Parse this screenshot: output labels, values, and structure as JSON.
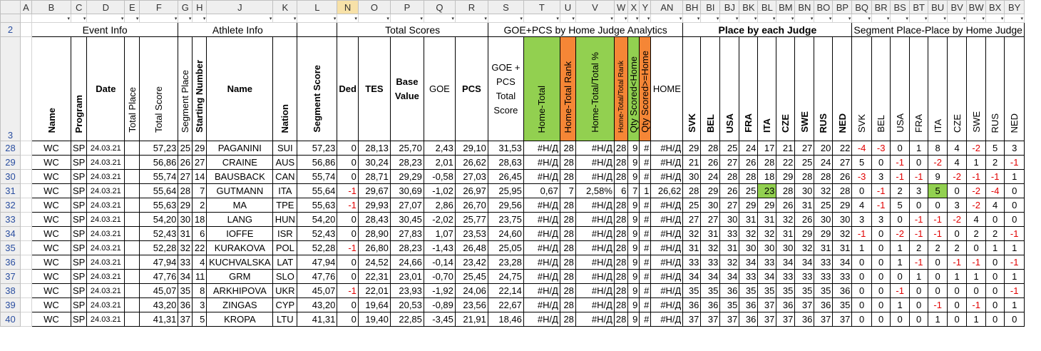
{
  "columns": [
    "",
    "A",
    "B",
    "C",
    "D",
    "E",
    "F",
    "G",
    "H",
    "J",
    "K",
    "L",
    "N",
    "O",
    "P",
    "Q",
    "R",
    "S",
    "T",
    "U",
    "V",
    "W",
    "X",
    "Y",
    "AN",
    "BH",
    "BI",
    "BJ",
    "BK",
    "BL",
    "BM",
    "BN",
    "BO",
    "BP",
    "BQ",
    "BR",
    "BS",
    "BT",
    "BU",
    "BV",
    "BW",
    "BX",
    "BY"
  ],
  "selected_column": "N",
  "header_row_numbers": [
    "",
    "2",
    "3"
  ],
  "groups": {
    "event_info": "Event Info",
    "athlete_info": "Athlete Info",
    "total_scores": "Total Scores",
    "goe_pcs": "GOE+PCS by Home Judge Analytics",
    "place_each_judge": "Place by each Judge",
    "segment_place": "Segment Place-Place by Home Judge"
  },
  "headers": {
    "name": "Name",
    "program": "Program",
    "date": "Date",
    "total_place": "Total Place",
    "total_score": "Total Score",
    "segment_place": "Segment Place",
    "starting_number": "Starting Number",
    "athlete_name": "Name",
    "nation": "Nation",
    "segment_score": "Segment Score",
    "ded": "Ded",
    "tes": "TES",
    "base_value": "Base Value",
    "goe": "GOE",
    "pcs": "PCS",
    "goe_pcs_total": "GOE + PCS Total Score",
    "home_total": "Home-Total",
    "home_total_rank": "Home-Total Rank",
    "home_total_pct": "Home-Total/Total %",
    "home_total_total_rank": "Home-Total/Total Rank",
    "qty_lt": "Qty Scored<Home",
    "qty_ge": "Qty Scored>=Home",
    "home": "HOME",
    "judges": [
      "SVK",
      "BEL",
      "USA",
      "FRA",
      "ITA",
      "CZE",
      "SWE",
      "RUS",
      "NED"
    ],
    "seg_judges": [
      "SVK",
      "BEL",
      "USA",
      "FRA",
      "ITA",
      "CZE",
      "SWE",
      "RUS",
      "NED"
    ]
  },
  "rows": [
    {
      "row": "28",
      "ev": "WC",
      "prog": "SP",
      "date": "24.03.21",
      "tp": "",
      "ts": "57,23",
      "sp": "25",
      "sn": "29",
      "name": "PAGANINI",
      "nat": "SUI",
      "ss": "57,23",
      "ded": "0",
      "tes": "28,13",
      "bv": "25,70",
      "goe": "2,43",
      "pcs": "29,10",
      "gp": "31,53",
      "ht": "#Н/Д",
      "htr": "28",
      "htp": "#Н/Д",
      "httr": "28",
      "ql": "9",
      "qg": "#",
      "home": "#Н/Д",
      "pl": [
        "29",
        "28",
        "25",
        "24",
        "17",
        "21",
        "27",
        "20",
        "22"
      ],
      "sg": [
        "-4",
        "-3",
        "0",
        "1",
        "8",
        "4",
        "-2",
        "5",
        "3"
      ]
    },
    {
      "row": "29",
      "ev": "WC",
      "prog": "SP",
      "date": "24.03.21",
      "tp": "",
      "ts": "56,86",
      "sp": "26",
      "sn": "27",
      "name": "CRAINE",
      "nat": "AUS",
      "ss": "56,86",
      "ded": "0",
      "tes": "30,24",
      "bv": "28,23",
      "goe": "2,01",
      "pcs": "26,62",
      "gp": "28,63",
      "ht": "#Н/Д",
      "htr": "28",
      "htp": "#Н/Д",
      "httr": "28",
      "ql": "9",
      "qg": "#",
      "home": "#Н/Д",
      "pl": [
        "21",
        "26",
        "27",
        "26",
        "28",
        "22",
        "25",
        "24",
        "27"
      ],
      "sg": [
        "5",
        "0",
        "-1",
        "0",
        "-2",
        "4",
        "1",
        "2",
        "-1"
      ]
    },
    {
      "row": "30",
      "ev": "WC",
      "prog": "SP",
      "date": "24.03.21",
      "tp": "",
      "ts": "55,74",
      "sp": "27",
      "sn": "14",
      "name": "BAUSBACK",
      "nat": "CAN",
      "ss": "55,74",
      "ded": "0",
      "tes": "28,71",
      "bv": "29,29",
      "goe": "-0,58",
      "pcs": "27,03",
      "gp": "26,45",
      "ht": "#Н/Д",
      "htr": "28",
      "htp": "#Н/Д",
      "httr": "28",
      "ql": "9",
      "qg": "#",
      "home": "#Н/Д",
      "pl": [
        "30",
        "24",
        "28",
        "28",
        "18",
        "29",
        "28",
        "28",
        "26"
      ],
      "sg": [
        "-3",
        "3",
        "-1",
        "-1",
        "9",
        "-2",
        "-1",
        "-1",
        "1"
      ]
    },
    {
      "row": "31",
      "ev": "WC",
      "prog": "SP",
      "date": "24.03.21",
      "tp": "",
      "ts": "55,64",
      "sp": "28",
      "sn": "7",
      "name": "GUTMANN",
      "nat": "ITA",
      "ss": "55,64",
      "ded": "-1",
      "tes": "29,67",
      "bv": "30,69",
      "goe": "-1,02",
      "pcs": "26,97",
      "gp": "25,95",
      "ht": "0,67",
      "htr": "7",
      "htp": "2,58%",
      "httr": "6",
      "ql": "7",
      "qg": "1",
      "home": "26,62",
      "pl": [
        "28",
        "29",
        "26",
        "25",
        "23",
        "28",
        "30",
        "32",
        "28"
      ],
      "sg": [
        "0",
        "-1",
        "2",
        "3",
        "5",
        "0",
        "-2",
        "-4",
        "0"
      ]
    },
    {
      "row": "32",
      "ev": "WC",
      "prog": "SP",
      "date": "24.03.21",
      "tp": "",
      "ts": "55,63",
      "sp": "29",
      "sn": "2",
      "name": "MA",
      "nat": "TPE",
      "ss": "55,63",
      "ded": "-1",
      "tes": "29,93",
      "bv": "27,07",
      "goe": "2,86",
      "pcs": "26,70",
      "gp": "29,56",
      "ht": "#Н/Д",
      "htr": "28",
      "htp": "#Н/Д",
      "httr": "28",
      "ql": "9",
      "qg": "#",
      "home": "#Н/Д",
      "pl": [
        "25",
        "30",
        "27",
        "29",
        "29",
        "26",
        "31",
        "25",
        "29"
      ],
      "sg": [
        "4",
        "-1",
        "5",
        "0",
        "0",
        "3",
        "-2",
        "4",
        "0"
      ]
    },
    {
      "row": "33",
      "ev": "WC",
      "prog": "SP",
      "date": "24.03.21",
      "tp": "",
      "ts": "54,20",
      "sp": "30",
      "sn": "18",
      "name": "LANG",
      "nat": "HUN",
      "ss": "54,20",
      "ded": "0",
      "tes": "28,43",
      "bv": "30,45",
      "goe": "-2,02",
      "pcs": "25,77",
      "gp": "23,75",
      "ht": "#Н/Д",
      "htr": "28",
      "htp": "#Н/Д",
      "httr": "28",
      "ql": "9",
      "qg": "#",
      "home": "#Н/Д",
      "pl": [
        "27",
        "27",
        "30",
        "31",
        "31",
        "32",
        "26",
        "30",
        "30"
      ],
      "sg": [
        "3",
        "3",
        "0",
        "-1",
        "-1",
        "-2",
        "4",
        "0",
        "0"
      ]
    },
    {
      "row": "34",
      "ev": "WC",
      "prog": "SP",
      "date": "24.03.21",
      "tp": "",
      "ts": "52,43",
      "sp": "31",
      "sn": "6",
      "name": "IOFFE",
      "nat": "ISR",
      "ss": "52,43",
      "ded": "0",
      "tes": "28,90",
      "bv": "27,83",
      "goe": "1,07",
      "pcs": "23,53",
      "gp": "24,60",
      "ht": "#Н/Д",
      "htr": "28",
      "htp": "#Н/Д",
      "httr": "28",
      "ql": "9",
      "qg": "#",
      "home": "#Н/Д",
      "pl": [
        "32",
        "31",
        "33",
        "32",
        "32",
        "31",
        "29",
        "29",
        "32"
      ],
      "sg": [
        "-1",
        "0",
        "-2",
        "-1",
        "-1",
        "0",
        "2",
        "2",
        "-1"
      ]
    },
    {
      "row": "35",
      "ev": "WC",
      "prog": "SP",
      "date": "24.03.21",
      "tp": "",
      "ts": "52,28",
      "sp": "32",
      "sn": "22",
      "name": "KURAKOVA",
      "nat": "POL",
      "ss": "52,28",
      "ded": "-1",
      "tes": "26,80",
      "bv": "28,23",
      "goe": "-1,43",
      "pcs": "26,48",
      "gp": "25,05",
      "ht": "#Н/Д",
      "htr": "28",
      "htp": "#Н/Д",
      "httr": "28",
      "ql": "9",
      "qg": "#",
      "home": "#Н/Д",
      "pl": [
        "31",
        "32",
        "31",
        "30",
        "30",
        "30",
        "32",
        "31",
        "31"
      ],
      "sg": [
        "1",
        "0",
        "1",
        "2",
        "2",
        "2",
        "0",
        "1",
        "1"
      ]
    },
    {
      "row": "36",
      "ev": "WC",
      "prog": "SP",
      "date": "24.03.21",
      "tp": "",
      "ts": "47,94",
      "sp": "33",
      "sn": "4",
      "name": "KUCHVALSKA",
      "nat": "LAT",
      "ss": "47,94",
      "ded": "0",
      "tes": "24,52",
      "bv": "24,66",
      "goe": "-0,14",
      "pcs": "23,42",
      "gp": "23,28",
      "ht": "#Н/Д",
      "htr": "28",
      "htp": "#Н/Д",
      "httr": "28",
      "ql": "9",
      "qg": "#",
      "home": "#Н/Д",
      "pl": [
        "33",
        "33",
        "32",
        "34",
        "33",
        "34",
        "34",
        "33",
        "34"
      ],
      "sg": [
        "0",
        "0",
        "1",
        "-1",
        "0",
        "-1",
        "-1",
        "0",
        "-1"
      ]
    },
    {
      "row": "37",
      "ev": "WC",
      "prog": "SP",
      "date": "24.03.21",
      "tp": "",
      "ts": "47,76",
      "sp": "34",
      "sn": "11",
      "name": "GRM",
      "nat": "SLO",
      "ss": "47,76",
      "ded": "0",
      "tes": "22,31",
      "bv": "23,01",
      "goe": "-0,70",
      "pcs": "25,45",
      "gp": "24,75",
      "ht": "#Н/Д",
      "htr": "28",
      "htp": "#Н/Д",
      "httr": "28",
      "ql": "9",
      "qg": "#",
      "home": "#Н/Д",
      "pl": [
        "34",
        "34",
        "34",
        "33",
        "34",
        "33",
        "33",
        "33",
        "33"
      ],
      "sg": [
        "0",
        "0",
        "0",
        "1",
        "0",
        "1",
        "1",
        "0",
        "1"
      ]
    },
    {
      "row": "38",
      "ev": "WC",
      "prog": "SP",
      "date": "24.03.21",
      "tp": "",
      "ts": "45,07",
      "sp": "35",
      "sn": "8",
      "name": "ARKHIPOVA",
      "nat": "UKR",
      "ss": "45,07",
      "ded": "-1",
      "tes": "22,01",
      "bv": "23,93",
      "goe": "-1,92",
      "pcs": "24,06",
      "gp": "22,14",
      "ht": "#Н/Д",
      "htr": "28",
      "htp": "#Н/Д",
      "httr": "28",
      "ql": "9",
      "qg": "#",
      "home": "#Н/Д",
      "pl": [
        "35",
        "35",
        "36",
        "35",
        "35",
        "35",
        "35",
        "35",
        "36"
      ],
      "sg": [
        "0",
        "0",
        "-1",
        "0",
        "0",
        "0",
        "0",
        "0",
        "-1"
      ]
    },
    {
      "row": "39",
      "ev": "WC",
      "prog": "SP",
      "date": "24.03.21",
      "tp": "",
      "ts": "43,20",
      "sp": "36",
      "sn": "3",
      "name": "ZINGAS",
      "nat": "CYP",
      "ss": "43,20",
      "ded": "0",
      "tes": "19,64",
      "bv": "20,53",
      "goe": "-0,89",
      "pcs": "23,56",
      "gp": "22,67",
      "ht": "#Н/Д",
      "htr": "28",
      "htp": "#Н/Д",
      "httr": "28",
      "ql": "9",
      "qg": "#",
      "home": "#Н/Д",
      "pl": [
        "36",
        "36",
        "35",
        "36",
        "37",
        "36",
        "37",
        "36",
        "35"
      ],
      "sg": [
        "0",
        "0",
        "1",
        "0",
        "-1",
        "0",
        "-1",
        "0",
        "1"
      ]
    },
    {
      "row": "40",
      "ev": "WC",
      "prog": "SP",
      "date": "24.03.21",
      "tp": "",
      "ts": "41,31",
      "sp": "37",
      "sn": "5",
      "name": "KROPA",
      "nat": "LTU",
      "ss": "41,31",
      "ded": "0",
      "tes": "19,40",
      "bv": "22,85",
      "goe": "-3,45",
      "pcs": "21,91",
      "gp": "18,46",
      "ht": "#Н/Д",
      "htr": "28",
      "htp": "#Н/Д",
      "httr": "28",
      "ql": "9",
      "qg": "#",
      "home": "#Н/Д",
      "pl": [
        "37",
        "37",
        "37",
        "36",
        "37",
        "37",
        "36",
        "37",
        "37"
      ],
      "sg": [
        "0",
        "0",
        "0",
        "0",
        "1",
        "0",
        "1",
        "0",
        "0"
      ]
    }
  ],
  "colors": {
    "green": "#92d050",
    "orange": "#f58636",
    "negative": "#e00000",
    "selected_column": "#f7e1a8"
  }
}
